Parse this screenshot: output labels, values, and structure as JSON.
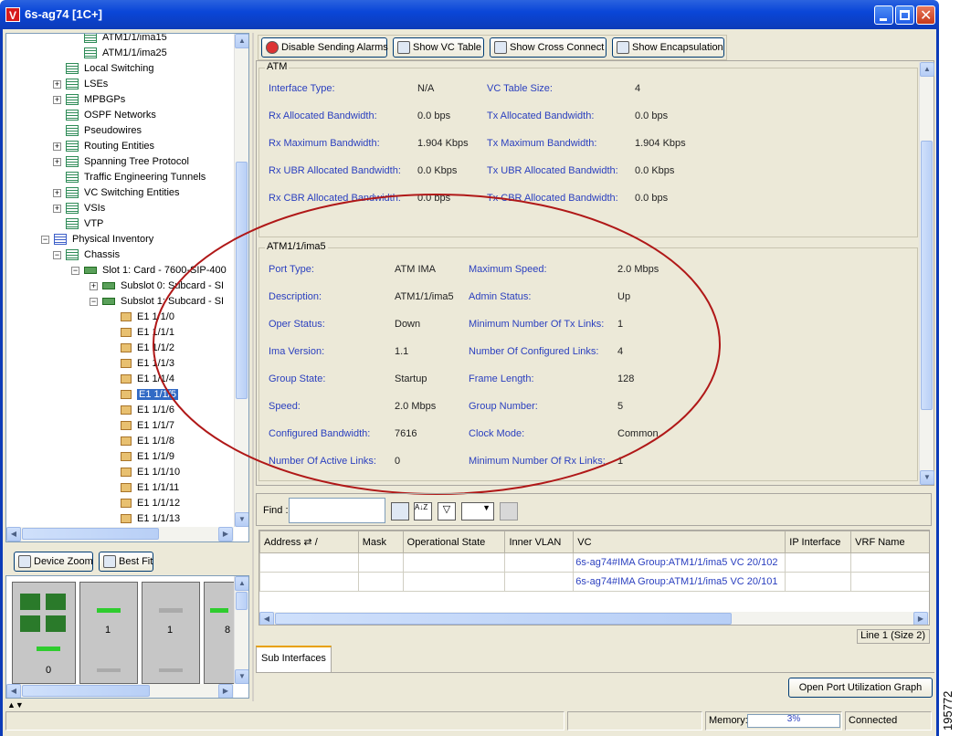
{
  "window": {
    "title": "6s-ag74 [1C+]",
    "app_icon_letter": "V"
  },
  "tree": {
    "items": [
      {
        "label": "ATM1/1/ima15",
        "level": 3
      },
      {
        "label": "ATM1/1/ima25",
        "level": 3
      },
      {
        "label": "Local Switching",
        "level": 2
      },
      {
        "label": "LSEs",
        "level": 2
      },
      {
        "label": "MPBGPs",
        "level": 2
      },
      {
        "label": "OSPF Networks",
        "level": 2
      },
      {
        "label": "Pseudowires",
        "level": 2
      },
      {
        "label": "Routing Entities",
        "level": 2
      },
      {
        "label": "Spanning Tree Protocol",
        "level": 2
      },
      {
        "label": "Traffic Engineering Tunnels",
        "level": 2
      },
      {
        "label": "VC Switching Entities",
        "level": 2
      },
      {
        "label": "VSIs",
        "level": 2
      },
      {
        "label": "VTP",
        "level": 2
      },
      {
        "label": "Physical Inventory",
        "level": 1
      },
      {
        "label": "Chassis",
        "level": 2
      },
      {
        "label": "Slot 1: Card - 7600-SIP-400",
        "level": 3
      },
      {
        "label": "Subslot 0: Subcard - SI",
        "level": 4
      },
      {
        "label": "Subslot 1: Subcard - SI",
        "level": 4
      },
      {
        "label": "E1 1/1/0",
        "level": 5
      },
      {
        "label": "E1 1/1/1",
        "level": 5
      },
      {
        "label": "E1 1/1/2",
        "level": 5
      },
      {
        "label": "E1 1/1/3",
        "level": 5
      },
      {
        "label": "E1 1/1/4",
        "level": 5
      },
      {
        "label": "E1 1/1/5",
        "level": 5,
        "selected": true
      },
      {
        "label": "E1 1/1/6",
        "level": 5
      },
      {
        "label": "E1 1/1/7",
        "level": 5
      },
      {
        "label": "E1 1/1/8",
        "level": 5
      },
      {
        "label": "E1 1/1/9",
        "level": 5
      },
      {
        "label": "E1 1/1/10",
        "level": 5
      },
      {
        "label": "E1 1/1/11",
        "level": 5
      },
      {
        "label": "E1 1/1/12",
        "level": 5
      },
      {
        "label": "E1 1/1/13",
        "level": 5
      }
    ]
  },
  "zoom": {
    "device_zoom": "Device Zoom",
    "best_fit": "Best Fit"
  },
  "rack_labels": [
    "0",
    "1",
    "1",
    "8"
  ],
  "toolbar": {
    "disable_alarms": "Disable Sending Alarms",
    "show_vc_table": "Show VC Table",
    "show_cross_connect": "Show Cross Connect",
    "show_encapsulation": "Show Encapsulation"
  },
  "atm": {
    "title": "ATM",
    "rows": [
      {
        "l1": "Interface Type:",
        "v1": "N/A",
        "l2": "VC Table Size:",
        "v2": "4"
      },
      {
        "l1": "Rx Allocated Bandwidth:",
        "v1": "0.0 bps",
        "l2": "Tx Allocated Bandwidth:",
        "v2": "0.0 bps"
      },
      {
        "l1": "Rx Maximum Bandwidth:",
        "v1": "1.904 Kbps",
        "l2": "Tx Maximum Bandwidth:",
        "v2": "1.904 Kbps"
      },
      {
        "l1": "Rx UBR Allocated Bandwidth:",
        "v1": "0.0 Kbps",
        "l2": "Tx UBR Allocated Bandwidth:",
        "v2": "0.0 Kbps"
      },
      {
        "l1": "Rx CBR Allocated Bandwidth:",
        "v1": "0.0 bps",
        "l2": "Tx CBR Allocated Bandwidth:",
        "v2": "0.0 bps"
      }
    ]
  },
  "ima": {
    "title": "ATM1/1/ima5",
    "rows": [
      {
        "l1": "Port Type:",
        "v1": "ATM IMA",
        "l2": "Maximum Speed:",
        "v2": "2.0 Mbps"
      },
      {
        "l1": "Description:",
        "v1": "ATM1/1/ima5",
        "l2": "Admin Status:",
        "v2": "Up"
      },
      {
        "l1": "Oper Status:",
        "v1": "Down",
        "l2": "Minimum Number Of Tx Links:",
        "v2": "1"
      },
      {
        "l1": "Ima Version:",
        "v1": "1.1",
        "l2": "Number Of Configured Links:",
        "v2": "4"
      },
      {
        "l1": "Group State:",
        "v1": "Startup",
        "l2": "Frame Length:",
        "v2": "128"
      },
      {
        "l1": "Speed:",
        "v1": "2.0 Mbps",
        "l2": "Group Number:",
        "v2": "5"
      },
      {
        "l1": "Configured Bandwidth:",
        "v1": "7616",
        "l2": "Clock Mode:",
        "v2": "Common"
      },
      {
        "l1": "Number Of Active Links:",
        "v1": "0",
        "l2": "Minimum Number Of Rx Links:",
        "v2": "1"
      }
    ]
  },
  "find": {
    "label": "Find :",
    "value": ""
  },
  "table": {
    "columns": [
      "Address",
      "Mask",
      "Operational State",
      "Inner VLAN",
      "VC",
      "IP Interface",
      "VRF Name"
    ],
    "rows": [
      [
        "",
        "",
        "",
        "",
        "6s-ag74#IMA Group:ATM1/1/ima5 VC 20/102",
        "",
        ""
      ],
      [
        "",
        "",
        "",
        "",
        "6s-ag74#IMA Group:ATM1/1/ima5 VC 20/101",
        "",
        ""
      ]
    ],
    "status": "Line 1 (Size 2)"
  },
  "tabs": {
    "sub_interfaces": "Sub Interfaces"
  },
  "open_port_util": "Open Port Utilization Graph",
  "statusbar": {
    "memory_label": "Memory:",
    "memory_value": "3%",
    "connection": "Connected"
  },
  "side_number": "195772",
  "colors": {
    "accent": "#2a3fbf",
    "annotation_ellipse": "#b01818",
    "selection": "#316ac5"
  }
}
